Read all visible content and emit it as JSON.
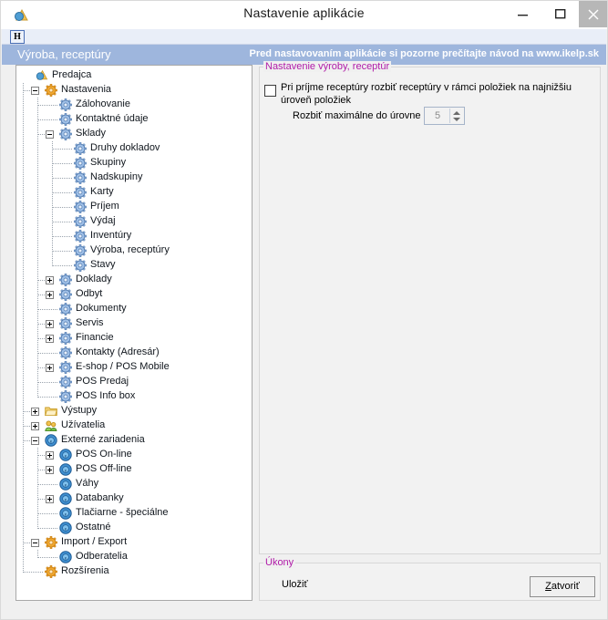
{
  "window": {
    "title": "Nastavenie aplikácie",
    "app_icon": "app-logo-icon",
    "controls": {
      "minimize": "minimize-icon",
      "maximize": "maximize-icon",
      "close": "close-icon"
    }
  },
  "toolbar": {
    "help_button": "H"
  },
  "band": {
    "section_title": "Výroba, receptúry",
    "notice": "Pred nastavovaním aplikácie si pozorne prečítajte návod na www.ikelp.sk"
  },
  "tree": {
    "nodes": [
      {
        "label": "Predajca",
        "depth": 0,
        "icon": "app-logo-icon",
        "toggle": "none"
      },
      {
        "label": "Nastavenia",
        "depth": 1,
        "icon": "orange-gear-icon",
        "toggle": "minus"
      },
      {
        "label": "Zálohovanie",
        "depth": 2,
        "icon": "blue-gear-icon",
        "toggle": "none"
      },
      {
        "label": "Kontaktné údaje",
        "depth": 2,
        "icon": "blue-gear-icon",
        "toggle": "none"
      },
      {
        "label": "Sklady",
        "depth": 2,
        "icon": "blue-gear-icon",
        "toggle": "minus"
      },
      {
        "label": "Druhy dokladov",
        "depth": 3,
        "icon": "blue-gear-icon",
        "toggle": "none"
      },
      {
        "label": "Skupiny",
        "depth": 3,
        "icon": "blue-gear-icon",
        "toggle": "none"
      },
      {
        "label": "Nadskupiny",
        "depth": 3,
        "icon": "blue-gear-icon",
        "toggle": "none"
      },
      {
        "label": "Karty",
        "depth": 3,
        "icon": "blue-gear-icon",
        "toggle": "none"
      },
      {
        "label": "Príjem",
        "depth": 3,
        "icon": "blue-gear-icon",
        "toggle": "none"
      },
      {
        "label": "Výdaj",
        "depth": 3,
        "icon": "blue-gear-icon",
        "toggle": "none"
      },
      {
        "label": "Inventúry",
        "depth": 3,
        "icon": "blue-gear-icon",
        "toggle": "none"
      },
      {
        "label": "Výroba, receptúry",
        "depth": 3,
        "icon": "blue-gear-icon",
        "toggle": "none"
      },
      {
        "label": "Stavy",
        "depth": 3,
        "icon": "blue-gear-icon",
        "toggle": "none"
      },
      {
        "label": "Doklady",
        "depth": 2,
        "icon": "blue-gear-icon",
        "toggle": "plus"
      },
      {
        "label": "Odbyt",
        "depth": 2,
        "icon": "blue-gear-icon",
        "toggle": "plus"
      },
      {
        "label": "Dokumenty",
        "depth": 2,
        "icon": "blue-gear-icon",
        "toggle": "none"
      },
      {
        "label": "Servis",
        "depth": 2,
        "icon": "blue-gear-icon",
        "toggle": "plus"
      },
      {
        "label": "Financie",
        "depth": 2,
        "icon": "blue-gear-icon",
        "toggle": "plus"
      },
      {
        "label": "Kontakty (Adresár)",
        "depth": 2,
        "icon": "blue-gear-icon",
        "toggle": "none"
      },
      {
        "label": "E-shop / POS Mobile",
        "depth": 2,
        "icon": "blue-gear-icon",
        "toggle": "plus"
      },
      {
        "label": "POS Predaj",
        "depth": 2,
        "icon": "blue-gear-icon",
        "toggle": "none"
      },
      {
        "label": "POS Info box",
        "depth": 2,
        "icon": "blue-gear-icon",
        "toggle": "none"
      },
      {
        "label": "Výstupy",
        "depth": 1,
        "icon": "folder-icon",
        "toggle": "plus"
      },
      {
        "label": "Užívatelia",
        "depth": 1,
        "icon": "users-icon",
        "toggle": "plus"
      },
      {
        "label": "Externé zariadenia",
        "depth": 1,
        "icon": "blue-circle-icon",
        "toggle": "minus"
      },
      {
        "label": "POS On-line",
        "depth": 2,
        "icon": "blue-circle-icon",
        "toggle": "plus"
      },
      {
        "label": "POS Off-line",
        "depth": 2,
        "icon": "blue-circle-icon",
        "toggle": "plus"
      },
      {
        "label": "Váhy",
        "depth": 2,
        "icon": "blue-circle-icon",
        "toggle": "none"
      },
      {
        "label": "Databanky",
        "depth": 2,
        "icon": "blue-circle-icon",
        "toggle": "plus"
      },
      {
        "label": "Tlačiarne - špeciálne",
        "depth": 2,
        "icon": "blue-circle-icon",
        "toggle": "none"
      },
      {
        "label": "Ostatné",
        "depth": 2,
        "icon": "blue-circle-icon",
        "toggle": "none"
      },
      {
        "label": "Import / Export",
        "depth": 1,
        "icon": "orange-gear-icon",
        "toggle": "minus"
      },
      {
        "label": "Odberatelia",
        "depth": 2,
        "icon": "blue-circle-icon",
        "toggle": "none"
      },
      {
        "label": "Rozšírenia",
        "depth": 1,
        "icon": "orange-gear-icon",
        "toggle": "none"
      }
    ]
  },
  "settings_panel": {
    "group_label": "Nastavenie výroby, receptúr",
    "checkbox_label": "Pri príjme receptúry rozbiť receptúry v rámci položiek na najnižšiu úroveň položiek",
    "checkbox_checked": false,
    "spinner_label": "Rozbiť maximálne do úrovne",
    "spinner_value": "5",
    "spinner_enabled": false
  },
  "actions": {
    "group_label": "Úkony",
    "save_label": "Uložiť",
    "close_button": "Zatvoriť",
    "close_accel": "Z"
  },
  "colors": {
    "band": "#9eb6dd",
    "group_label": "#b01aa8",
    "toolbar": "#e9eef8"
  }
}
